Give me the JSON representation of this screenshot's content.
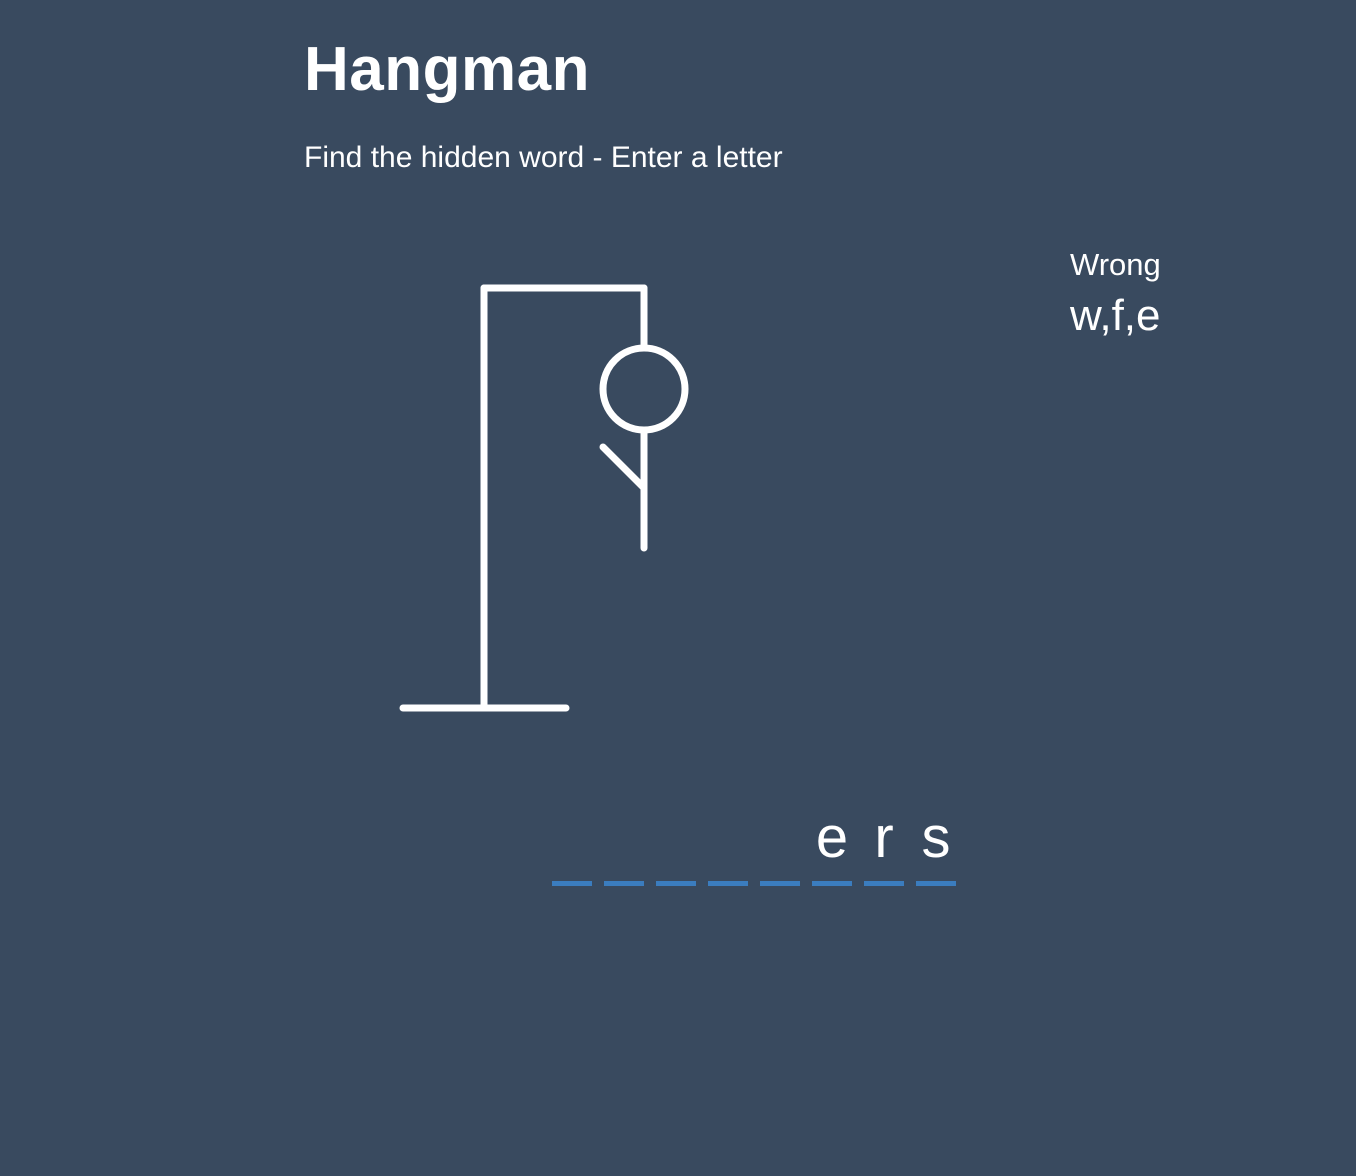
{
  "header": {
    "title": "Hangman",
    "instructions": "Find the hidden word - Enter a letter"
  },
  "wrong": {
    "label": "Wrong",
    "letters": "w,f,e"
  },
  "word": {
    "slots": [
      "",
      "",
      "",
      "",
      "",
      "e",
      "r",
      "s"
    ]
  },
  "figure": {
    "parts_shown": [
      "head",
      "body",
      "left-arm"
    ]
  },
  "colors": {
    "background": "#394a5f",
    "foreground": "#ffffff",
    "dash": "#3b7dbf"
  }
}
